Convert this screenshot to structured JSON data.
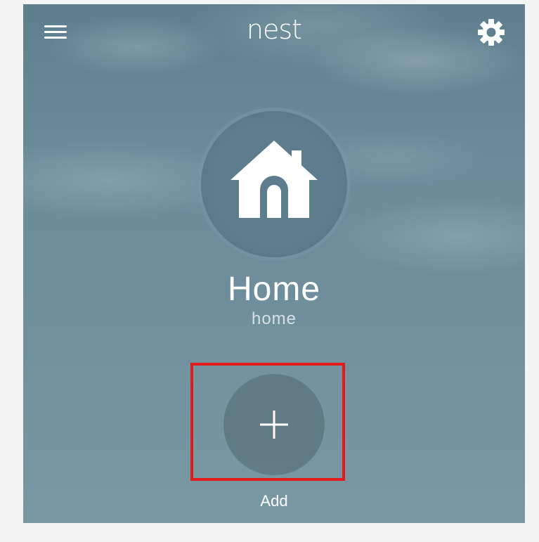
{
  "header": {
    "menu_icon": "hamburger-menu-icon",
    "logo_text": "nest",
    "settings_icon": "gear-icon"
  },
  "structure": {
    "icon": "home-icon",
    "name": "Home",
    "type": "home"
  },
  "add_device": {
    "icon": "plus-icon",
    "label": "Add"
  },
  "colors": {
    "background": "#6b8b9a",
    "home_circle": "#5d7d8d",
    "highlight": "#e31a1a",
    "foreground": "#ffffff"
  }
}
